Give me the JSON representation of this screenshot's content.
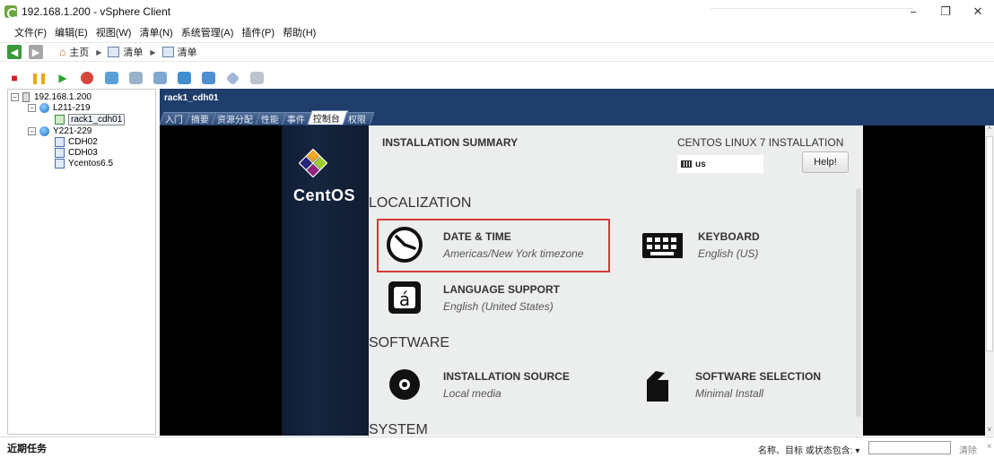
{
  "window": {
    "title": "192.168.1.200 - vSphere Client",
    "controls": [
      "−",
      "❐",
      "✕"
    ]
  },
  "menu": [
    "文件(F)",
    "编辑(E)",
    "视图(W)",
    "清单(N)",
    "系统管理(A)",
    "插件(P)",
    "帮助(H)"
  ],
  "nav": {
    "home": "主页",
    "crumbs": [
      "清单",
      "清单"
    ]
  },
  "tree": {
    "root": "192.168.1.200",
    "cluster1": "L211-219",
    "vm_selected": "rack1_cdh01",
    "cluster2": "Y221-229",
    "vms": [
      "CDH02",
      "CDH03",
      "Ycentos6.5"
    ]
  },
  "console": {
    "vm_name": "rack1_cdh01",
    "tabs": [
      "入门",
      "摘要",
      "资源分配",
      "性能",
      "事件",
      "控制台",
      "权限"
    ],
    "active_tab": "控制台"
  },
  "installer": {
    "brand": "CentOS",
    "title": "INSTALLATION SUMMARY",
    "right_title": "CENTOS LINUX 7 INSTALLATION",
    "keyboard_layout": "us",
    "help": "Help!",
    "sections": {
      "localization": "LOCALIZATION",
      "software": "SOFTWARE",
      "system": "SYSTEM"
    },
    "spokes": {
      "datetime": {
        "title": "DATE & TIME",
        "sub": "Americas/New York timezone"
      },
      "keyboard": {
        "title": "KEYBOARD",
        "sub": "English (US)"
      },
      "language": {
        "title": "LANGUAGE SUPPORT",
        "sub": "English (United States)"
      },
      "source": {
        "title": "INSTALLATION SOURCE",
        "sub": "Local media"
      },
      "selection": {
        "title": "SOFTWARE SELECTION",
        "sub": "Minimal Install"
      }
    }
  },
  "status": {
    "recent_tasks": "近期任务",
    "filter_label": "名称、目标 或状态包含: ▾",
    "clear": "清除",
    "close": "×"
  },
  "colors": {
    "vm_header": "#1f3e6b",
    "installer_bg": "#eceeee",
    "highlight": "#d43a3a"
  }
}
